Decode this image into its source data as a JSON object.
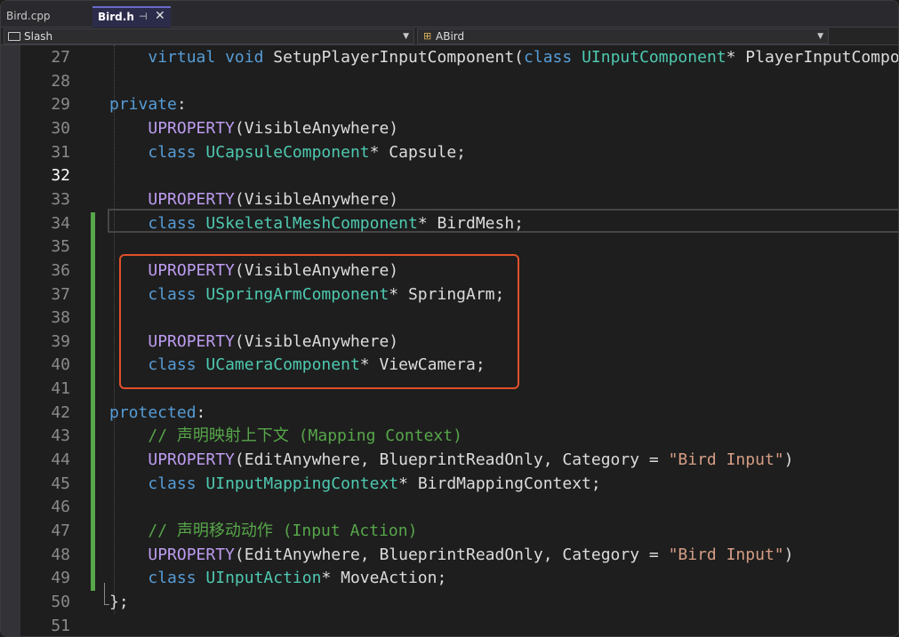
{
  "tabs": [
    {
      "label": "Bird.cpp"
    },
    {
      "label": "Bird.h",
      "pin_icon": "⊣",
      "close_icon": "✕"
    }
  ],
  "nav": {
    "scope_dropdown": "Slash",
    "member_dropdown": "ABird"
  },
  "editor": {
    "current_line": "32",
    "lines": [
      {
        "num": "27",
        "segments": [
          [
            "",
            "    "
          ],
          [
            "kw",
            "virtual"
          ],
          [
            "",
            " "
          ],
          [
            "kw",
            "void"
          ],
          [
            "",
            " SetupPlayerInputComponent("
          ],
          [
            "kw",
            "class"
          ],
          [
            "",
            " "
          ],
          [
            "type",
            "UInputComponent"
          ],
          [
            "",
            "* PlayerInputComponent) "
          ]
        ]
      },
      {
        "num": "28",
        "segments": []
      },
      {
        "num": "29",
        "segments": [
          [
            "kw",
            "private"
          ],
          [
            "",
            ":"
          ]
        ]
      },
      {
        "num": "30",
        "segments": [
          [
            "",
            "    "
          ],
          [
            "macro",
            "UPROPERTY"
          ],
          [
            "",
            "(VisibleAnywhere)"
          ]
        ]
      },
      {
        "num": "31",
        "segments": [
          [
            "",
            "    "
          ],
          [
            "kw",
            "class"
          ],
          [
            "",
            " "
          ],
          [
            "type",
            "UCapsuleComponent"
          ],
          [
            "",
            "* Capsule;"
          ]
        ]
      },
      {
        "num": "32",
        "segments": []
      },
      {
        "num": "33",
        "segments": [
          [
            "",
            "    "
          ],
          [
            "macro",
            "UPROPERTY"
          ],
          [
            "",
            "(VisibleAnywhere)"
          ]
        ]
      },
      {
        "num": "34",
        "segments": [
          [
            "",
            "    "
          ],
          [
            "kw",
            "class"
          ],
          [
            "",
            " "
          ],
          [
            "type",
            "USkeletalMeshComponent"
          ],
          [
            "",
            "* BirdMesh;"
          ]
        ]
      },
      {
        "num": "35",
        "segments": []
      },
      {
        "num": "36",
        "segments": [
          [
            "",
            "    "
          ],
          [
            "macro",
            "UPROPERTY"
          ],
          [
            "",
            "(VisibleAnywhere)"
          ]
        ]
      },
      {
        "num": "37",
        "segments": [
          [
            "",
            "    "
          ],
          [
            "kw",
            "class"
          ],
          [
            "",
            " "
          ],
          [
            "type",
            "USpringArmComponent"
          ],
          [
            "",
            "* SpringArm;"
          ]
        ]
      },
      {
        "num": "38",
        "segments": []
      },
      {
        "num": "39",
        "segments": [
          [
            "",
            "    "
          ],
          [
            "macro",
            "UPROPERTY"
          ],
          [
            "",
            "(VisibleAnywhere)"
          ]
        ]
      },
      {
        "num": "40",
        "segments": [
          [
            "",
            "    "
          ],
          [
            "kw",
            "class"
          ],
          [
            "",
            " "
          ],
          [
            "type",
            "UCameraComponent"
          ],
          [
            "",
            "* ViewCamera;"
          ]
        ]
      },
      {
        "num": "41",
        "segments": []
      },
      {
        "num": "42",
        "segments": [
          [
            "kw",
            "protected"
          ],
          [
            "",
            ":"
          ]
        ]
      },
      {
        "num": "43",
        "segments": [
          [
            "",
            "    "
          ],
          [
            "cmt",
            "// 声明映射上下文 (Mapping Context)"
          ]
        ]
      },
      {
        "num": "44",
        "segments": [
          [
            "",
            "    "
          ],
          [
            "macro",
            "UPROPERTY"
          ],
          [
            "",
            "(EditAnywhere, BlueprintReadOnly, Category = "
          ],
          [
            "str",
            "\"Bird Input\""
          ],
          [
            "",
            ")"
          ]
        ]
      },
      {
        "num": "45",
        "segments": [
          [
            "",
            "    "
          ],
          [
            "kw",
            "class"
          ],
          [
            "",
            " "
          ],
          [
            "type",
            "UInputMappingContext"
          ],
          [
            "",
            "* BirdMappingContext;"
          ]
        ]
      },
      {
        "num": "46",
        "segments": []
      },
      {
        "num": "47",
        "segments": [
          [
            "",
            "    "
          ],
          [
            "cmt",
            "// 声明移动动作 (Input Action)"
          ]
        ]
      },
      {
        "num": "48",
        "segments": [
          [
            "",
            "    "
          ],
          [
            "macro",
            "UPROPERTY"
          ],
          [
            "",
            "(EditAnywhere, BlueprintReadOnly, Category = "
          ],
          [
            "str",
            "\"Bird Input\""
          ],
          [
            "",
            ")"
          ]
        ]
      },
      {
        "num": "49",
        "segments": [
          [
            "",
            "    "
          ],
          [
            "kw",
            "class"
          ],
          [
            "",
            " "
          ],
          [
            "type",
            "UInputAction"
          ],
          [
            "",
            "* MoveAction;"
          ]
        ]
      },
      {
        "num": "50",
        "segments": [
          [
            "",
            "};"
          ]
        ]
      },
      {
        "num": "51",
        "segments": []
      }
    ]
  },
  "colors": {
    "keyword": "#569cd6",
    "macro": "#bd9cf0",
    "type": "#4ec9b0",
    "string": "#d69d85",
    "comment": "#57a64a",
    "highlight_box": "#e0502a",
    "change_bar": "#57a64a"
  }
}
